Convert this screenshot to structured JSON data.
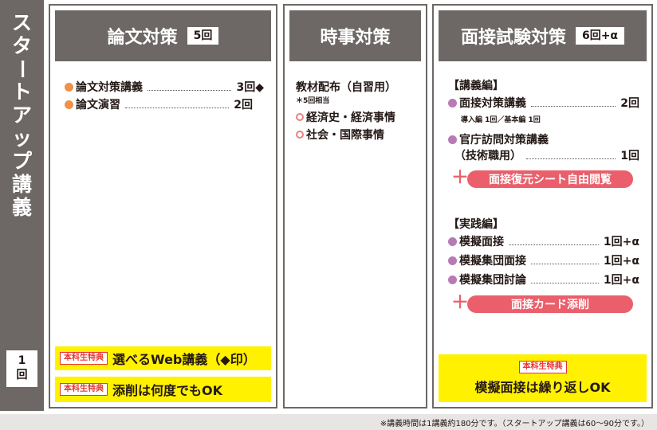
{
  "sidebar": {
    "title_chars": [
      "ス",
      "タ",
      "ー",
      "ト",
      "ア",
      "ッ",
      "プ",
      "講",
      "義"
    ],
    "session_num": "1",
    "session_unit": "回"
  },
  "col1": {
    "title": "論文対策",
    "badge": "5回",
    "items": [
      {
        "label": "論文対策講義",
        "count": "3回◆"
      },
      {
        "label": "論文演習",
        "count": "2回"
      }
    ],
    "benefits": [
      {
        "tag": "本科生特典",
        "text": "選べるWeb講義（◆印）"
      },
      {
        "tag": "本科生特典",
        "text": "添削は何度でもOK"
      }
    ]
  },
  "col2": {
    "title": "時事対策",
    "material_title": "教材配布（自習用）",
    "material_note": "＊5回相当",
    "items": [
      "経済史・経済事情",
      "社会・国際事情"
    ]
  },
  "col3": {
    "title": "面接試験対策",
    "badge": "6回+α",
    "lecture_header": "【講義編】",
    "lecture_items": [
      {
        "label": "面接対策講義",
        "count": "2回",
        "note": "導入編 1回／基本編 1回"
      },
      {
        "label": "官庁訪問対策講義",
        "label2": "（技術職用）",
        "count": "1回"
      }
    ],
    "plus1": "面接復元シート自由閲覧",
    "practice_header": "【実践編】",
    "practice_items": [
      {
        "label": "模擬面接",
        "count": "1回+α"
      },
      {
        "label": "模擬集団面接",
        "count": "1回+α"
      },
      {
        "label": "模擬集団討論",
        "count": "1回+α"
      }
    ],
    "plus2": "面接カード添削",
    "benefit_tag": "本科生特典",
    "benefit_text": "模擬面接は繰り返しOK"
  },
  "footer": "※講義時間は1講義約180分です。（スタートアップ講義は60～90分です。）",
  "colors": {
    "gray": "#6d6866",
    "orange": "#ef9149",
    "purple": "#b87ab5",
    "pink": "#ea5f6b",
    "yellow": "#fff100"
  }
}
